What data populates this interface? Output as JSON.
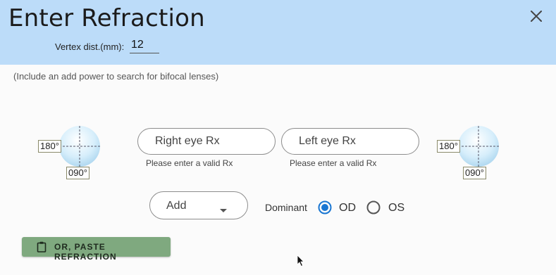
{
  "dialog": {
    "title": "Enter Refraction",
    "close_icon": "close-icon"
  },
  "vertex": {
    "label": "Vertex dist.(mm):",
    "value": "12"
  },
  "hint": "(Include an add power to search for bifocal lenses)",
  "axis": {
    "left": {
      "horizontal": "180°",
      "vertical": "090°"
    },
    "right": {
      "horizontal": "180°",
      "vertical": "090°"
    }
  },
  "right_eye": {
    "placeholder": "Right eye Rx",
    "helper": "Please enter a valid Rx"
  },
  "left_eye": {
    "placeholder": "Left eye Rx",
    "helper": "Please enter a valid Rx"
  },
  "add_select": {
    "label": "Add",
    "icon": "chevron-down-icon"
  },
  "dominant": {
    "label": "Dominant",
    "options": [
      {
        "label": "OD",
        "selected": true
      },
      {
        "label": "OS",
        "selected": false
      }
    ]
  },
  "paste_button": {
    "label": "OR, PASTE REFRACTION",
    "icon": "clipboard-icon"
  },
  "colors": {
    "header_bg": "#bcdcf9",
    "accent": "#1976d2",
    "button_bg": "#7fa97f"
  }
}
